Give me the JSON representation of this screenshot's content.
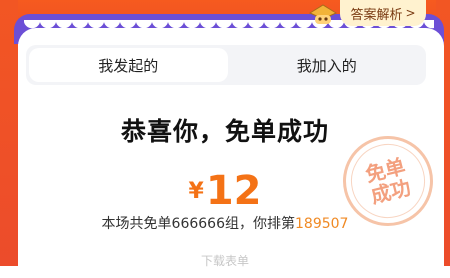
{
  "header": {
    "answer_button_label": "答案解析",
    "answer_button_chevron": ">",
    "mascot_icon": "cap-mascot-icon"
  },
  "tabs": [
    {
      "label": "我发起的",
      "active": true
    },
    {
      "label": "我加入的",
      "active": false
    }
  ],
  "result": {
    "headline": "恭喜你，免单成功",
    "currency_symbol": "¥",
    "amount": "12",
    "rank_prefix": "本场共免单666666组，你排第",
    "rank_number": "189507"
  },
  "stamp": {
    "line1": "免单",
    "line2": "成功"
  },
  "footer": {
    "faint_text": "下载表单"
  },
  "colors": {
    "accent_orange": "#f47216",
    "background_red": "#ee4f24",
    "ridge_purple": "#6c4fd6",
    "answer_button_bg": "#fff2cf"
  }
}
